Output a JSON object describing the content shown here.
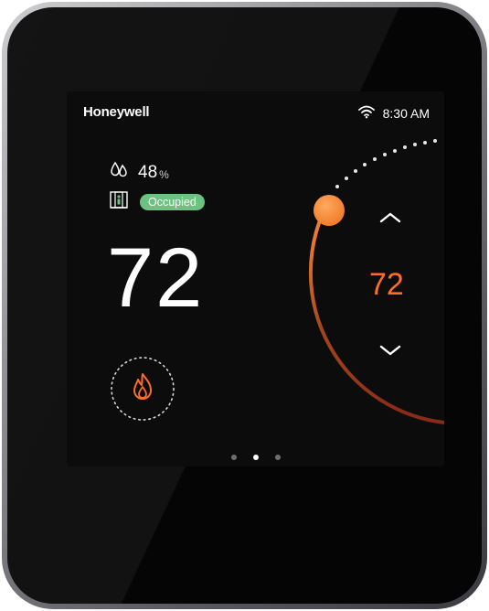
{
  "brand": {
    "name": "Honeywell"
  },
  "status": {
    "time": "8:30 AM",
    "wifi_icon": "wifi-icon"
  },
  "humidity": {
    "value": "48",
    "unit": "%"
  },
  "occupancy": {
    "status": "Occupied"
  },
  "temperature": {
    "current": "72",
    "setpoint": "72"
  },
  "mode": {
    "icon": "flame-icon",
    "name": "heat"
  },
  "pager": {
    "total": 3,
    "active_index": 1
  },
  "colors": {
    "accent": "#ff6d2a",
    "occupied_badge": "#6cc381",
    "screen_bg": "#0c0c0d",
    "text": "#ffffff"
  }
}
